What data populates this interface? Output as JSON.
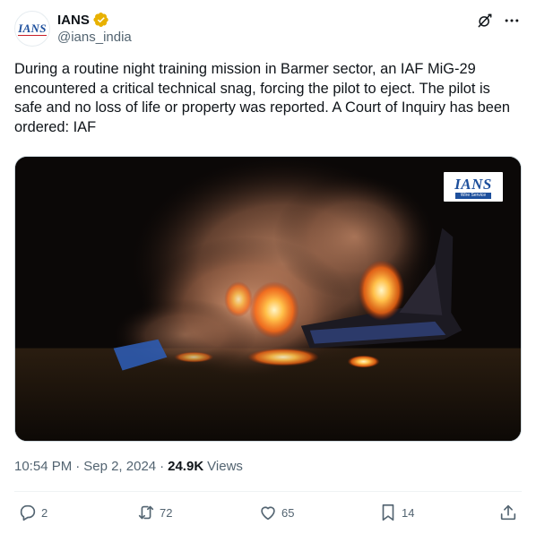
{
  "account": {
    "display_name": "IANS",
    "handle": "@ians_india",
    "avatar_text": "IANS",
    "verified_color": "#e8b100"
  },
  "tweet": {
    "text": "During a routine night training mission in Barmer sector, an IAF MiG-29 encountered a critical technical snag, forcing the pilot to eject. The pilot is safe and no loss of life or property was reported. A Court of Inquiry has been ordered: IAF"
  },
  "media": {
    "watermark_main": "IANS",
    "watermark_sub": "Wire Service"
  },
  "meta": {
    "time": "10:54 PM",
    "separator": "·",
    "date": "Sep 2, 2024",
    "views_count": "24.9K",
    "views_label": "Views"
  },
  "actions": {
    "replies": "2",
    "reposts": "72",
    "likes": "65",
    "bookmarks": "14"
  },
  "icons": {
    "grok": "grok-icon",
    "more": "more-icon",
    "reply": "reply-icon",
    "repost": "repost-icon",
    "like": "like-icon",
    "bookmark": "bookmark-icon",
    "share": "share-icon"
  },
  "colors": {
    "text_primary": "#0f1419",
    "text_secondary": "#536471",
    "divider": "#eff3f4"
  }
}
